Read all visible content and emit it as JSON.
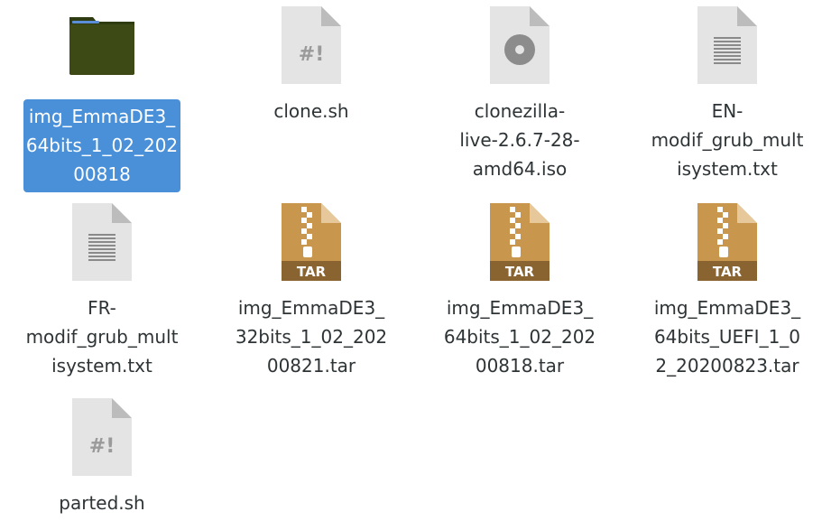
{
  "files": [
    {
      "icon": "folder-icon",
      "lines": [
        "img_EmmaDE3_",
        "64bits_1_02_202",
        "00818"
      ],
      "selected": true
    },
    {
      "icon": "script-icon",
      "lines": [
        "clone.sh"
      ],
      "selected": false
    },
    {
      "icon": "disc-image-icon",
      "lines": [
        "clonezilla-",
        "live-2.6.7-28-",
        "amd64.iso"
      ],
      "selected": false
    },
    {
      "icon": "text-file-icon",
      "lines": [
        "EN-",
        "modif_grub_mult",
        "isystem.txt"
      ],
      "selected": false
    },
    {
      "icon": "text-file-icon",
      "lines": [
        "FR-",
        "modif_grub_mult",
        "isystem.txt"
      ],
      "selected": false
    },
    {
      "icon": "tar-archive-icon",
      "lines": [
        "img_EmmaDE3_",
        "32bits_1_02_202",
        "00821.tar"
      ],
      "selected": false
    },
    {
      "icon": "tar-archive-icon",
      "lines": [
        "img_EmmaDE3_",
        "64bits_1_02_202",
        "00818.tar"
      ],
      "selected": false
    },
    {
      "icon": "tar-archive-icon",
      "lines": [
        "img_EmmaDE3_",
        "64bits_UEFI_1_0",
        "2_20200823.tar"
      ],
      "selected": false
    },
    {
      "icon": "script-icon",
      "lines": [
        "parted.sh"
      ],
      "selected": false
    }
  ],
  "icon_text": {
    "script": "#!",
    "tar": "TAR"
  },
  "colors": {
    "folder": "#3d4a16",
    "folder_tab": "#2e3a10",
    "selection": "#4a90d9",
    "file_page": "#e4e4e4",
    "file_fold": "#bcbcbc",
    "tar": "#c8964c"
  }
}
